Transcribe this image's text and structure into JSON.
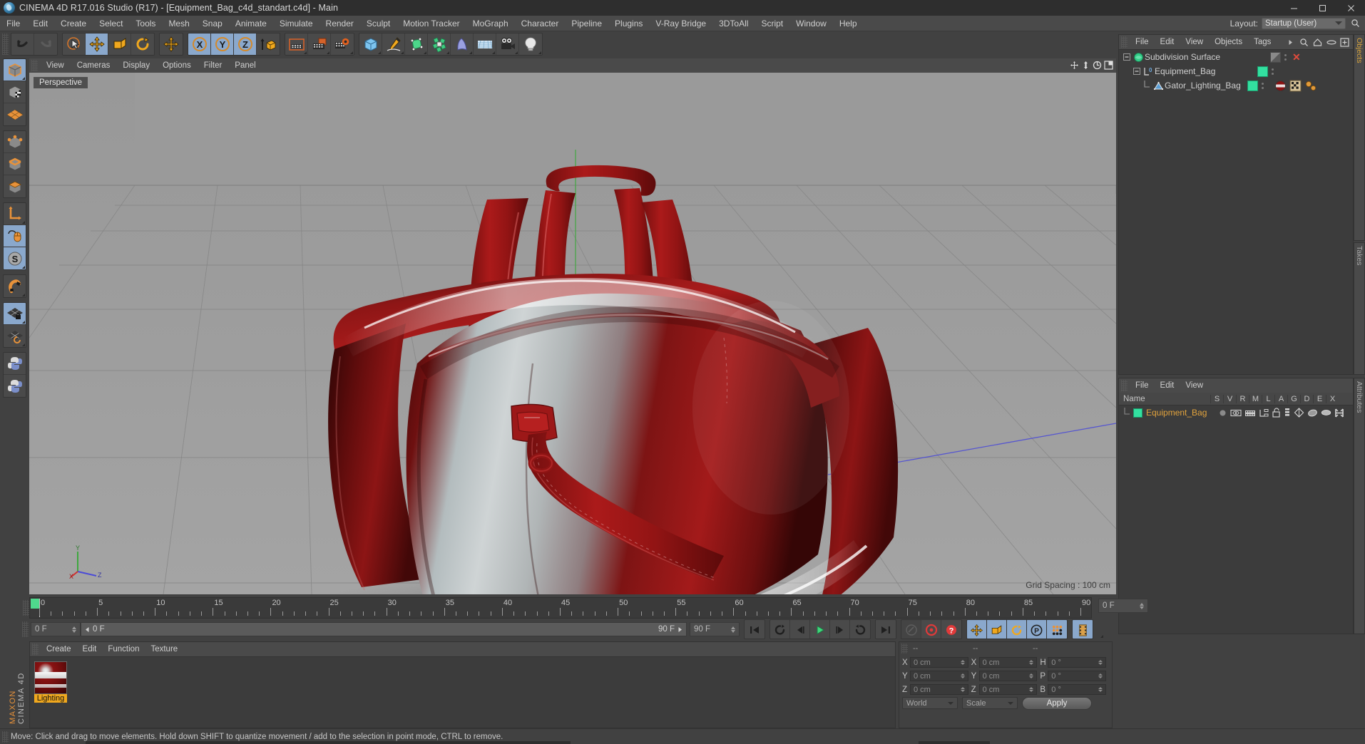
{
  "titlebar": {
    "title": "CINEMA 4D R17.016 Studio (R17) - [Equipment_Bag_c4d_standart.c4d] - Main",
    "minimize": "–",
    "maximize": "☐",
    "close": "✕"
  },
  "menubar": {
    "items": [
      "File",
      "Edit",
      "Create",
      "Select",
      "Tools",
      "Mesh",
      "Snap",
      "Animate",
      "Simulate",
      "Render",
      "Sculpt",
      "Motion Tracker",
      "MoGraph",
      "Character",
      "Pipeline",
      "Plugins",
      "V-Ray Bridge",
      "3DToAll",
      "Script",
      "Window",
      "Help"
    ],
    "layout_label": "Layout:",
    "layout_value": "Startup (User)"
  },
  "toolbar": {
    "buttons": [
      {
        "name": "undo-button",
        "icon": "undo",
        "state": "normal"
      },
      {
        "name": "redo-button",
        "icon": "redo",
        "state": "disabled"
      },
      {
        "name": "select-tool-button",
        "icon": "select-cursor",
        "state": "normal"
      },
      {
        "name": "move-tool-button",
        "icon": "move-arrows",
        "state": "active"
      },
      {
        "name": "scale-tool-button",
        "icon": "scale-box",
        "state": "normal"
      },
      {
        "name": "rotate-tool-button",
        "icon": "rotate-arc",
        "state": "normal"
      },
      {
        "name": "move-axis-button",
        "icon": "move-arrows",
        "state": "normal"
      },
      {
        "name": "x-axis-lock-button",
        "icon": "axis-x",
        "state": "active"
      },
      {
        "name": "y-axis-lock-button",
        "icon": "axis-y",
        "state": "active"
      },
      {
        "name": "z-axis-lock-button",
        "icon": "axis-z",
        "state": "active"
      },
      {
        "name": "world-object-coord-button",
        "icon": "world-cube",
        "state": "normal"
      },
      {
        "name": "render-view-button",
        "icon": "clapper",
        "state": "normal"
      },
      {
        "name": "render-to-picture-viewer-button",
        "icon": "clapper-picture",
        "state": "normal"
      },
      {
        "name": "render-settings-button",
        "icon": "clapper-gear",
        "state": "normal"
      },
      {
        "name": "add-cube-button",
        "icon": "cube-blue",
        "state": "normal"
      },
      {
        "name": "add-spline-button",
        "icon": "pen-spline",
        "state": "normal"
      },
      {
        "name": "add-nurbs-button",
        "icon": "generator-green",
        "state": "normal"
      },
      {
        "name": "add-array-button",
        "icon": "modeling-green",
        "state": "normal"
      },
      {
        "name": "add-deformer-button",
        "icon": "deformer-bend",
        "state": "normal"
      },
      {
        "name": "add-floor-button",
        "icon": "environment-floor",
        "state": "normal"
      },
      {
        "name": "add-camera-button",
        "icon": "camera",
        "state": "normal"
      },
      {
        "name": "add-light-button",
        "icon": "light-bulb",
        "state": "normal"
      }
    ]
  },
  "left_toolbar": {
    "buttons": [
      {
        "name": "model-mode-button",
        "icon": "model-cube",
        "state": "active"
      },
      {
        "name": "texture-mode-button",
        "icon": "texture-cube",
        "state": "normal"
      },
      {
        "name": "workplane-button",
        "icon": "workplane-grid",
        "state": "normal"
      },
      {
        "name": "point-mode-button",
        "icon": "points-cube",
        "state": "normal"
      },
      {
        "name": "edge-mode-button",
        "icon": "edges-cube",
        "state": "normal"
      },
      {
        "name": "polygon-mode-button",
        "icon": "polygon-cube",
        "state": "normal"
      },
      {
        "name": "axis-modify-button",
        "icon": "axis-l",
        "state": "normal"
      },
      {
        "name": "viewport-solo-button",
        "icon": "mouse-orange",
        "state": "active"
      },
      {
        "name": "enable-snap-button",
        "icon": "snap-s",
        "state": "active"
      },
      {
        "name": "magnet-button",
        "icon": "magnet",
        "state": "normal"
      },
      {
        "name": "workplane-lock-button",
        "icon": "grid-lock",
        "state": "active"
      },
      {
        "name": "workplane-rotate-button",
        "icon": "grid-rotate",
        "state": "normal"
      },
      {
        "name": "python-script-button",
        "icon": "python",
        "state": "normal"
      },
      {
        "name": "python-generator-button",
        "icon": "python",
        "state": "normal"
      }
    ],
    "brand_top": "MAXON",
    "brand_bottom": "CINEMA 4D"
  },
  "viewport": {
    "menu_items": [
      "View",
      "Cameras",
      "Display",
      "Options",
      "Filter",
      "Panel"
    ],
    "perspective_tag": "Perspective",
    "grid_spacing": "Grid Spacing : 100 cm",
    "axis_labels": {
      "y": "Y",
      "x": "X",
      "z": "Z"
    },
    "nav_icons": [
      "pan-icon",
      "zoom-icon",
      "rotate-icon",
      "maximize-viewport-icon"
    ]
  },
  "object_manager": {
    "menu_items": [
      "File",
      "Edit",
      "View",
      "Objects",
      "Tags"
    ],
    "header_icons": [
      "arrow-right-icon",
      "search-icon",
      "home-icon",
      "ellipse-icon",
      "add-layer-icon"
    ],
    "objects": [
      {
        "name": "Subdivision Surface",
        "indent": 0,
        "icon": "subdivision-surface-icon",
        "enable": "disabled",
        "has_x": true,
        "tags": []
      },
      {
        "name": "Equipment_Bag",
        "indent": 1,
        "icon": "object-level-icon",
        "enable": "enabled",
        "has_x": false,
        "tags": []
      },
      {
        "name": "Gator_Lighting_Bag",
        "indent": 2,
        "icon": "polygon-object-icon",
        "enable": "enabled",
        "has_x": false,
        "tags": [
          "material-tag",
          "uvw-tag",
          "phong-tag"
        ]
      }
    ],
    "side_tabs": [
      "Objects",
      "Takes"
    ]
  },
  "attribute_manager": {
    "menu_items": [
      "File",
      "Edit",
      "View"
    ],
    "columns": [
      "Name",
      "S",
      "V",
      "R",
      "M",
      "L",
      "A",
      "G",
      "D",
      "E",
      "X"
    ],
    "rows": [
      {
        "name": "Equipment_Bag",
        "color": "#33e0a0",
        "icons": [
          "dot-icon",
          "visibility-icon",
          "render-icon",
          "layer-icon",
          "unlock-icon",
          "list-icon",
          "generator-icon",
          "deformer-icon",
          "expression-icon",
          "motion-icon"
        ]
      }
    ],
    "side_tab": "Attributes"
  },
  "timeline": {
    "start_frame": "0 F",
    "end_frame": "90 F",
    "current_frame": "0 F",
    "preview_end": "90 F",
    "ticks": [
      0,
      5,
      10,
      15,
      20,
      25,
      30,
      35,
      40,
      45,
      50,
      55,
      60,
      65,
      70,
      75,
      80,
      85,
      90
    ]
  },
  "playback": {
    "frame_field": "0 F",
    "track_label": "0 F",
    "track_end": "90 F",
    "range_end": "90 F",
    "buttons": [
      {
        "name": "go-to-start-button",
        "icon": "skip-start"
      },
      {
        "name": "previous-key-button",
        "icon": "prev-key"
      },
      {
        "name": "step-back-button",
        "icon": "step-back"
      },
      {
        "name": "play-button",
        "icon": "play"
      },
      {
        "name": "step-forward-button",
        "icon": "step-forward"
      },
      {
        "name": "next-key-button",
        "icon": "next-key"
      },
      {
        "name": "go-to-end-button",
        "icon": "skip-end"
      },
      {
        "name": "autokey-button",
        "icon": "autokey"
      },
      {
        "name": "record-button",
        "icon": "record"
      },
      {
        "name": "keyframe-help-button",
        "icon": "question"
      },
      {
        "name": "record-position-button",
        "icon": "move-arrows"
      },
      {
        "name": "record-scale-button",
        "icon": "scale-box"
      },
      {
        "name": "record-rotation-button",
        "icon": "rotate-arc"
      },
      {
        "name": "record-param-button",
        "icon": "param-p"
      },
      {
        "name": "point-level-animation-button",
        "icon": "pla-dots"
      },
      {
        "name": "timeline-button",
        "icon": "filmstrip"
      }
    ]
  },
  "material_manager": {
    "menu_items": [
      "Create",
      "Edit",
      "Function",
      "Texture"
    ],
    "materials": [
      {
        "name": "Lighting"
      }
    ]
  },
  "coordinate_manager": {
    "headers": [
      "--",
      "--",
      "--"
    ],
    "rows": [
      {
        "label": "X",
        "position": "0 cm",
        "label2": "X",
        "size": "0 cm",
        "label3": "H",
        "rotation": "0 °"
      },
      {
        "label": "Y",
        "position": "0 cm",
        "label2": "Y",
        "size": "0 cm",
        "label3": "P",
        "rotation": "0 °"
      },
      {
        "label": "Z",
        "position": "0 cm",
        "label2": "Z",
        "size": "0 cm",
        "label3": "B",
        "rotation": "0 °"
      }
    ],
    "coord_system": "World",
    "transform_mode": "Scale",
    "apply_label": "Apply"
  },
  "statusbar": {
    "message": "Move: Click and drag to move elements. Hold down SHIFT to quantize movement / add to the selection in point mode, CTRL to remove."
  },
  "colors": {
    "accent_orange": "#e8923a",
    "active_blue": "#8aa8cc",
    "green_tag": "#33e0a0",
    "panel_bg": "#414141",
    "viewport_bg": "#9d9d9d",
    "bag_red": "#8a1212"
  }
}
